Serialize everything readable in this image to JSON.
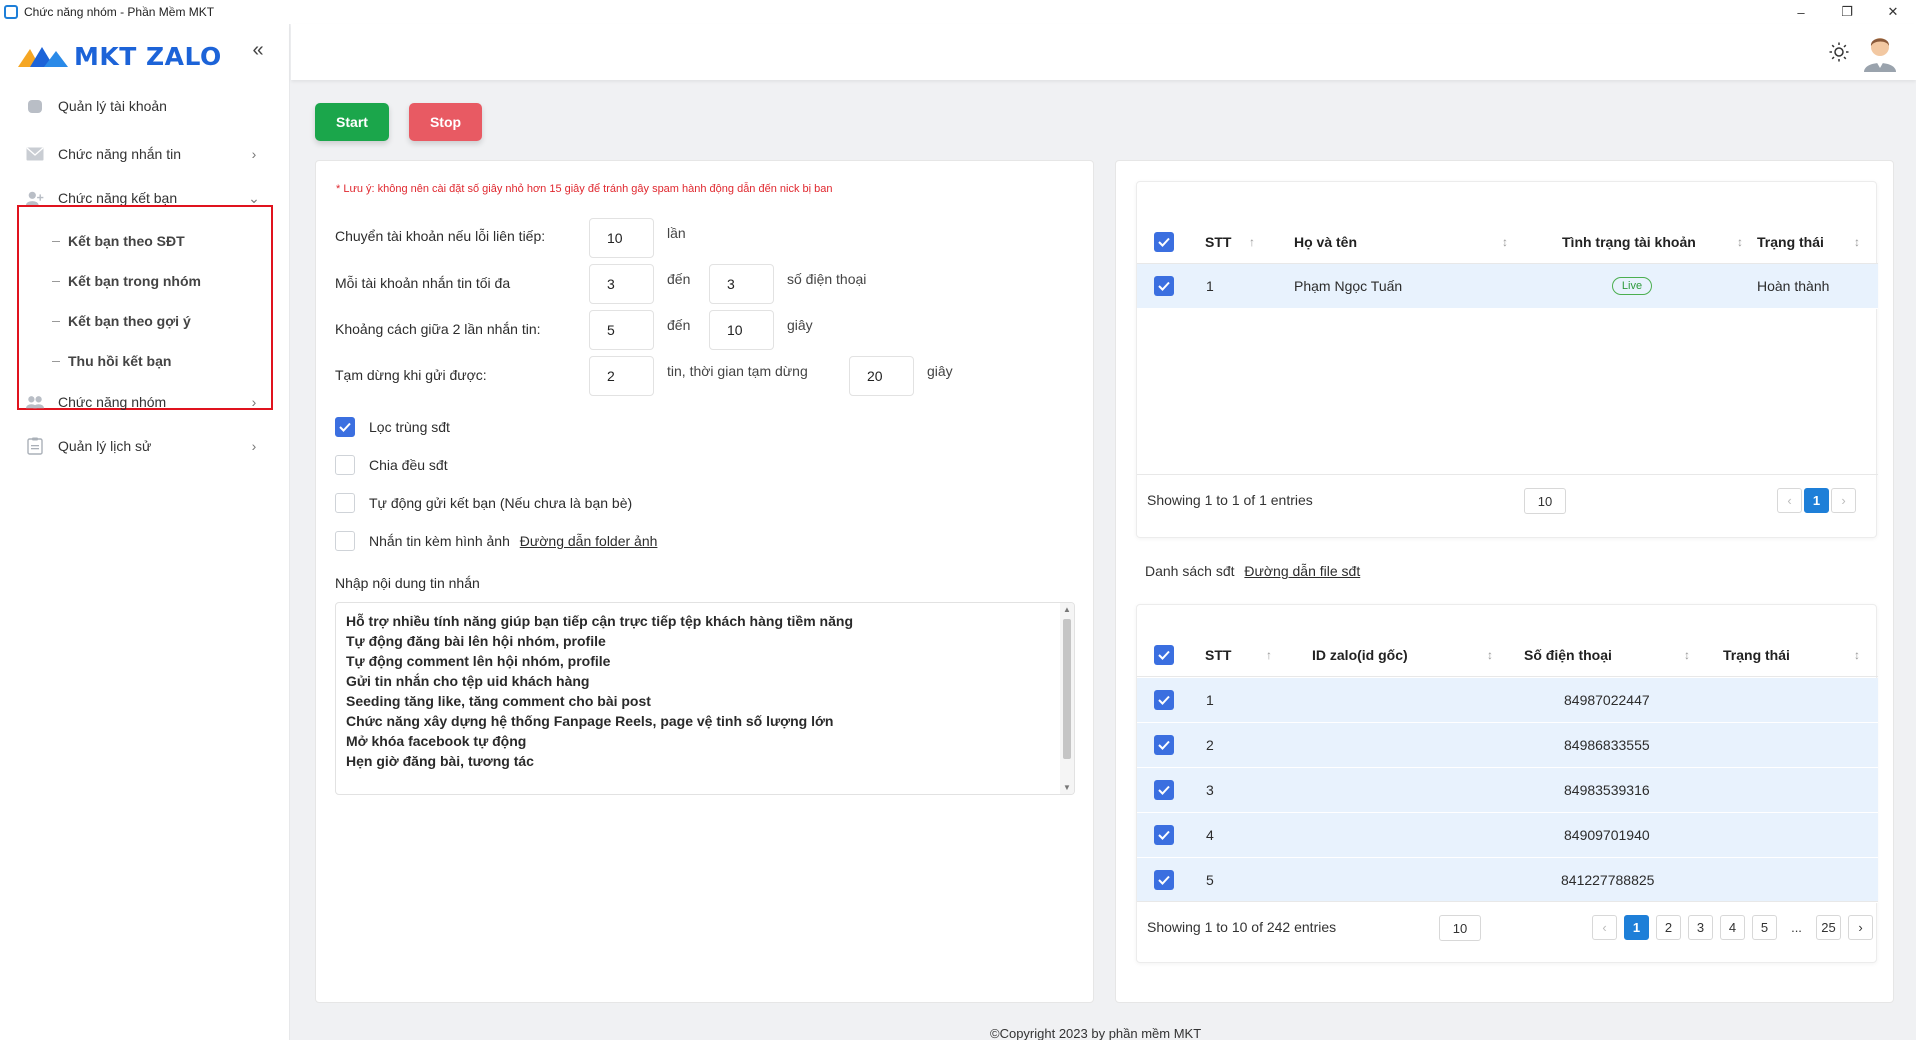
{
  "window": {
    "title": "Chức năng nhóm - Phần Mềm MKT",
    "minimize": "–",
    "restore": "❐",
    "close": "✕"
  },
  "sidebar": {
    "logo": "MKT ZALO",
    "collapse": "«",
    "items": [
      {
        "label": "Quản lý tài khoản"
      },
      {
        "label": "Chức năng nhắn tin"
      },
      {
        "label": "Chức năng kết bạn"
      },
      {
        "label": "Chức năng nhóm"
      },
      {
        "label": "Quản lý lịch sử"
      }
    ],
    "subitems": [
      {
        "label": "Kết bạn theo SĐT"
      },
      {
        "label": "Kết bạn trong nhóm"
      },
      {
        "label": "Kết bạn theo gợi ý"
      },
      {
        "label": "Thu hồi kết bạn"
      }
    ]
  },
  "toolbar": {
    "start": "Start",
    "stop": "Stop"
  },
  "settings": {
    "note": "* Lưu ý: không nên cài đặt số giây nhỏ hơn 15 giây để tránh gây spam hành động dẫn đến nick bị ban",
    "switch_label": "Chuyển tài khoản nếu lỗi liên tiếp:",
    "switch_value": "10",
    "switch_unit": "lần",
    "max_label": "Mỗi tài khoản nhắn tin tối đa",
    "max_from": "3",
    "max_to_word": "đến",
    "max_to": "3",
    "max_unit": "số điện thoại",
    "gap_label": "Khoảng cách giữa 2 lần nhắn tin:",
    "gap_from": "5",
    "gap_to_word": "đến",
    "gap_to": "10",
    "gap_unit": "giây",
    "pause_label": "Tạm dừng khi gửi được:",
    "pause_count": "2",
    "pause_mid": "tin, thời gian tạm dừng",
    "pause_time": "20",
    "pause_unit": "giây",
    "opt_dedupe": "Lọc trùng sđt",
    "opt_split": "Chia đều sđt",
    "opt_auto_add": "Tự động gửi kết bạn (Nếu chưa là bạn bè)",
    "opt_image": "Nhắn tin kèm hình ảnh",
    "image_link": "Đường dẫn folder ảnh",
    "msg_label": "Nhập nội dung tin nhắn",
    "msg_lines": [
      "Hỗ trợ nhiều tính năng giúp bạn tiếp cận trực tiếp tệp khách hàng tiềm năng",
      "Tự động đăng bài lên hội nhóm, profile",
      "Tự động comment lên hội nhóm, profile",
      "Gửi tin nhắn cho tệp uid khách hàng",
      "Seeding tăng like, tăng comment cho bài post",
      "Chức năng xây dựng hệ thống Fanpage Reels, page vệ tinh số lượng lớn",
      "Mở khóa facebook tự động",
      "Hẹn giờ đăng bài, tương tác"
    ]
  },
  "accounts_table": {
    "headers": [
      "STT",
      "Họ và tên",
      "Tình trạng tài khoản",
      "Trạng thái"
    ],
    "rows": [
      {
        "stt": "1",
        "name": "Phạm Ngọc Tuấn",
        "status": "Live",
        "state": "Hoàn thành"
      }
    ],
    "showing": "Showing 1 to 1 of 1 entries",
    "page_size": "10",
    "pages": [
      "‹",
      "1",
      "›"
    ]
  },
  "phone_list": {
    "label": "Danh sách sđt",
    "link": "Đường dẫn file sđt"
  },
  "phones_table": {
    "headers": [
      "STT",
      "ID zalo(id gốc)",
      "Số điện thoại",
      "Trạng thái"
    ],
    "rows": [
      {
        "stt": "1",
        "phone": "84987022447"
      },
      {
        "stt": "2",
        "phone": "84986833555"
      },
      {
        "stt": "3",
        "phone": "84983539316"
      },
      {
        "stt": "4",
        "phone": "84909701940"
      },
      {
        "stt": "5",
        "phone": "841227788825"
      }
    ],
    "showing": "Showing 1 to 10 of 242 entries",
    "page_size": "10",
    "pages": [
      "‹",
      "1",
      "2",
      "3",
      "4",
      "5",
      "...",
      "25",
      "›"
    ]
  },
  "footer": {
    "copyright": "©Copyright 2023 by phần mềm MKT"
  }
}
